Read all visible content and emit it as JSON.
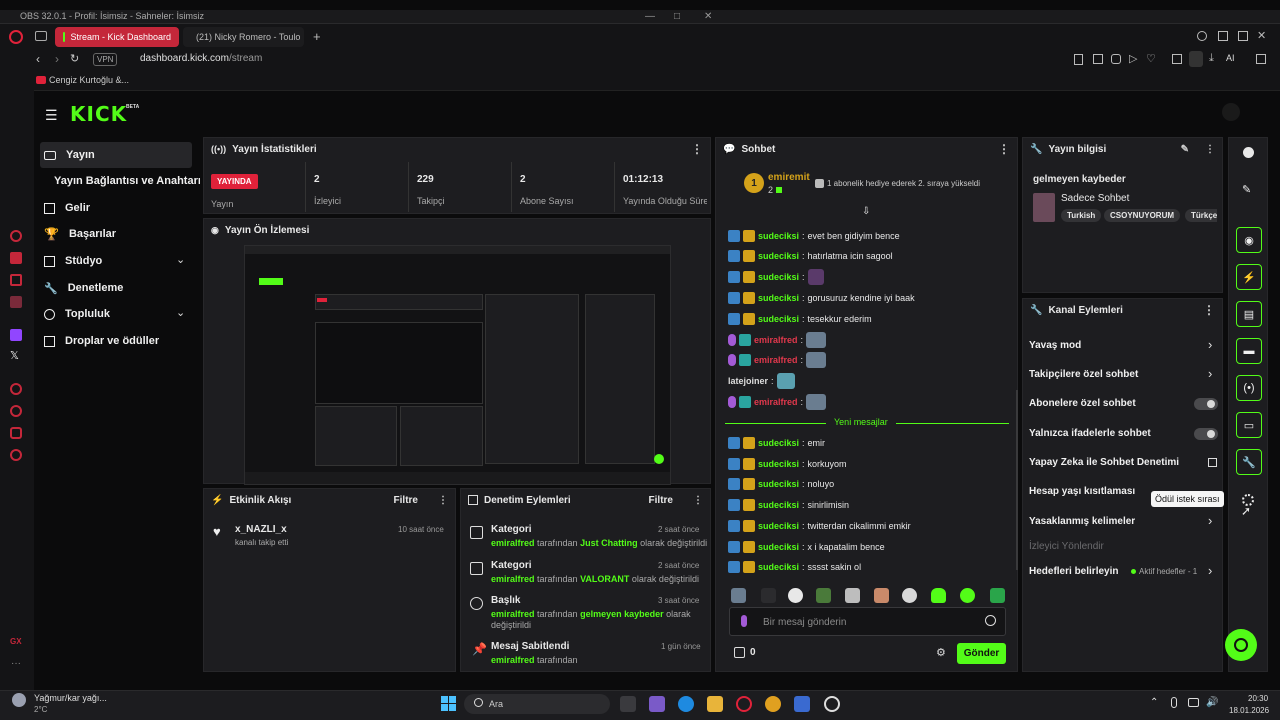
{
  "obs": {
    "title": "OBS 32.0.1 - Profil: İsimsiz - Sahneler: İsimsiz"
  },
  "browser": {
    "tabs": [
      {
        "label": "Stream - Kick Dashboard"
      },
      {
        "label": "(21) Nicky Romero - Toulo"
      }
    ],
    "url_host": "dashboard.kick.com",
    "url_path": "/stream",
    "vpn": "VPN",
    "bookmark": "Cengiz Kurtoğlu &...",
    "ai_label": "AI"
  },
  "brand": {
    "logo": "KICK",
    "beta": "BETA"
  },
  "sidebar": {
    "items": [
      {
        "label": "Yayın"
      },
      {
        "label": "Yayın Bağlantısı ve Anahtarı"
      },
      {
        "label": "Gelir"
      },
      {
        "label": "Başarılar"
      },
      {
        "label": "Stüdyo"
      },
      {
        "label": "Denetleme"
      },
      {
        "label": "Topluluk"
      },
      {
        "label": "Droplar ve ödüller"
      }
    ]
  },
  "stats": {
    "title": "Yayın İstatistikleri",
    "live": "YAYINDA",
    "live_label": "Yayın",
    "items": [
      {
        "value": "2",
        "label": "İzleyici"
      },
      {
        "value": "229",
        "label": "Takipçi"
      },
      {
        "value": "2",
        "label": "Abone Sayısı"
      },
      {
        "value": "01:12:13",
        "label": "Yayında Olduğu Süre"
      }
    ]
  },
  "preview": {
    "title": "Yayın Ön İzlemesi"
  },
  "activity": {
    "title": "Etkinlik Akışı",
    "filter": "Filtre",
    "item": {
      "user": "x_NAZLI_x",
      "text": "kanalı takip etti",
      "time": "10 saat önce"
    }
  },
  "moderation": {
    "title": "Denetim Eylemleri",
    "filter": "Filtre",
    "items": [
      {
        "title": "Kategori",
        "time": "2 saat önce",
        "user": "emiralfred",
        "mid": " tarafından ",
        "value": "Just Chatting",
        "tail": " olarak değiştirildi",
        "line2": ""
      },
      {
        "title": "Kategori",
        "time": "2 saat önce",
        "user": "emiralfred",
        "mid": " tarafından ",
        "value": "VALORANT",
        "tail": " olarak değiştirildi",
        "line2": ""
      },
      {
        "title": "Başlık",
        "time": "3 saat önce",
        "user": "emiralfred",
        "mid": " tarafından ",
        "value": "gelmeyen kaybeder",
        "tail": " olarak",
        "line2": "değiştirildi"
      },
      {
        "title": "Mesaj Sabitlendi",
        "time": "1 gün önce",
        "user": "emiralfred",
        "mid": " tarafından",
        "value": "",
        "tail": "",
        "line2": ""
      }
    ]
  },
  "chat": {
    "title": "Sohbet",
    "top_gifter": {
      "rank": "1",
      "name": "emiremit",
      "count": "2"
    },
    "gift_note": "1 abonelik hediye ederek 2. sıraya yükseldi",
    "messages_old": [
      {
        "user": "sudeciksi",
        "text": "evet ben gidiyim bence"
      },
      {
        "user": "sudeciksi",
        "text": "hatırlatma icin sagool"
      },
      {
        "user": "sudeciksi",
        "text": ""
      },
      {
        "user": "sudeciksi",
        "text": "gorusuruz kendine iyi baak"
      },
      {
        "user": "sudeciksi",
        "text": "tesekkur ederim"
      },
      {
        "user": "emiralfred",
        "text": ""
      },
      {
        "user": "emiralfred",
        "text": ""
      },
      {
        "user": "latejoiner",
        "text": ""
      },
      {
        "user": "emiralfred",
        "text": ""
      }
    ],
    "new_divider": "Yeni mesajlar",
    "messages_new": [
      {
        "user": "sudeciksi",
        "text": "emir"
      },
      {
        "user": "sudeciksi",
        "text": "korkuyom"
      },
      {
        "user": "sudeciksi",
        "text": "noluyo"
      },
      {
        "user": "sudeciksi",
        "text": "sinirlimisin"
      },
      {
        "user": "sudeciksi",
        "text": "twitterdan cikalimmi emkir"
      },
      {
        "user": "sudeciksi",
        "text": "x i kapatalim bence"
      },
      {
        "user": "sudeciksi",
        "text": "sssst sakin ol"
      }
    ],
    "input_placeholder": "Bir mesaj gönderin",
    "points": "0",
    "send": "Gönder"
  },
  "stream_info": {
    "title": "Yayın bilgisi",
    "stream_title": "gelmeyen kaybeder",
    "category": "Sadece Sohbet",
    "tags": [
      "Turkish",
      "CSOYNUYORUM",
      "Türkçe"
    ]
  },
  "channel_actions": {
    "title": "Kanal Eylemleri",
    "items": [
      {
        "label": "Yavaş mod"
      },
      {
        "label": "Takipçilere özel sohbet"
      },
      {
        "label": "Abonelere özel sohbet"
      },
      {
        "label": "Yalnızca ifadelerle sohbet"
      },
      {
        "label": "Yapay Zeka ile Sohbet Denetimi"
      },
      {
        "label": "Hesap yaşı kısıtlaması"
      },
      {
        "label": "Yasaklanmış kelimeler"
      },
      {
        "label": "İzleyici Yönlendir"
      },
      {
        "label": "Hedefleri belirleyin"
      }
    ],
    "goals_status": "Aktif hedefler - 1",
    "tooltip": "Ödül istek sırası"
  },
  "taskbar": {
    "weather": "Yağmur/kar yağı...",
    "temp": "2°C",
    "search": "Ara",
    "time": "20:30",
    "date": "18.01.2026"
  },
  "colors": {
    "kick_green": "#53fc18",
    "live_red": "#e0223a",
    "panel": "#1d1d20"
  }
}
